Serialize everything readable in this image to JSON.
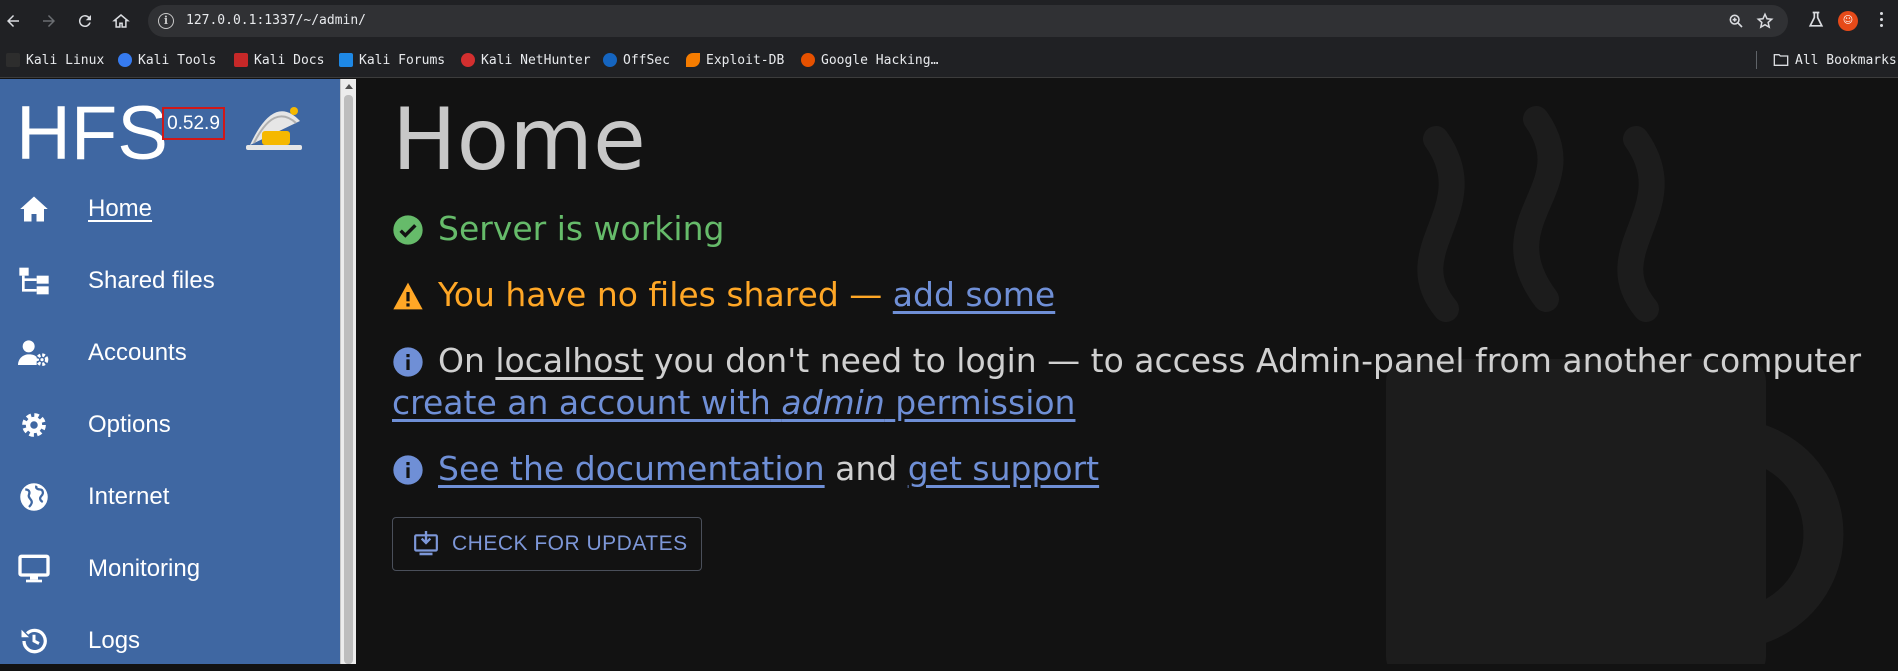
{
  "browser": {
    "url": "127.0.0.1:1337/~/admin/",
    "bookmarks": [
      {
        "label": "Kali Linux",
        "color": "#2d2d2d"
      },
      {
        "label": "Kali Tools",
        "color": "#367bf0"
      },
      {
        "label": "Kali Docs",
        "color": "#c62828"
      },
      {
        "label": "Kali Forums",
        "color": "#1e88e5"
      },
      {
        "label": "Kali NetHunter",
        "color": "#d32f2f"
      },
      {
        "label": "OffSec",
        "color": "#1565c0"
      },
      {
        "label": "Exploit-DB",
        "color": "#f57c00"
      },
      {
        "label": "Google Hacking…",
        "color": "#e65100"
      }
    ],
    "all_bookmarks": "All Bookmarks"
  },
  "sidebar": {
    "brand": "HFS",
    "version": "0.52.9",
    "items": [
      {
        "label": "Home",
        "icon": "home-icon",
        "active": true
      },
      {
        "label": "Shared files",
        "icon": "tree-icon"
      },
      {
        "label": "Accounts",
        "icon": "user-gear-icon"
      },
      {
        "label": "Options",
        "icon": "gear-icon"
      },
      {
        "label": "Internet",
        "icon": "globe-icon"
      },
      {
        "label": "Monitoring",
        "icon": "monitor-icon"
      },
      {
        "label": "Logs",
        "icon": "history-icon"
      }
    ]
  },
  "main": {
    "title": "Home",
    "status": "Server is working",
    "warning_text": "You have no files shared —",
    "warning_link": "add some",
    "info1_on": "On",
    "info1_localhost": "localhost",
    "info1_rest": "you don't need to login — to access Admin-panel from another computer",
    "info1_link_a": "create an account with",
    "info1_link_admin": "admin",
    "info1_link_b": "permission",
    "info2_link_docs": "See the documentation",
    "info2_and": "and",
    "info2_link_support": "get support",
    "update_button": "CHECK FOR UPDATES"
  },
  "colors": {
    "sidebar_bg": "#3f67a2",
    "success": "#66bb6a",
    "warning": "#ffa726",
    "link": "#6f8fd6",
    "version_border": "#d01818"
  }
}
